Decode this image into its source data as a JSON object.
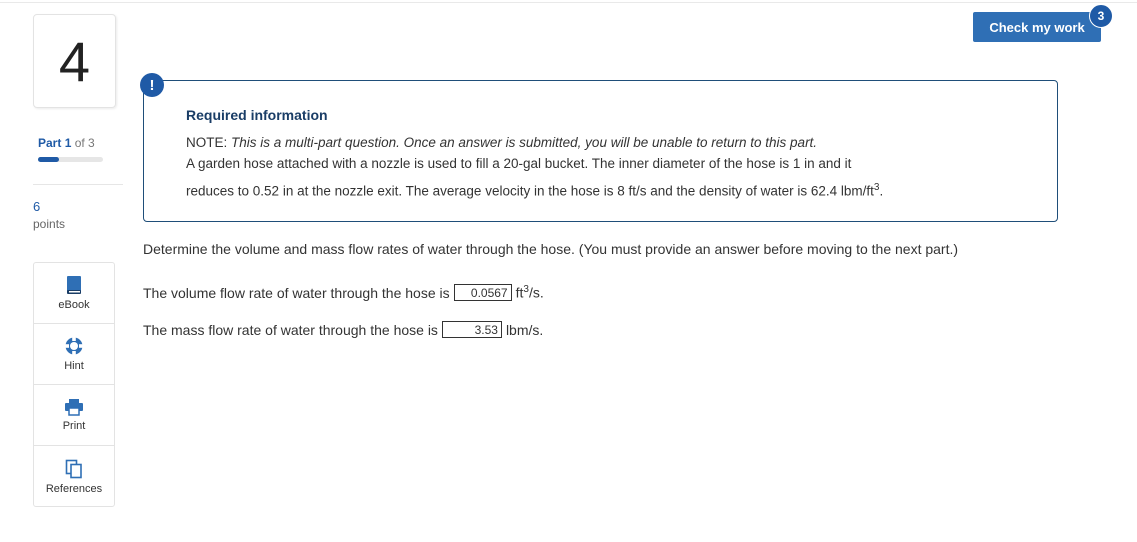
{
  "question_number": "4",
  "part": {
    "prefix": "Part",
    "current": "1",
    "of_text": "of 3",
    "progress": 0.33
  },
  "points": {
    "value": "6",
    "label": "points"
  },
  "tools": [
    {
      "label": "eBook",
      "icon": "book-icon"
    },
    {
      "label": "Hint",
      "icon": "lifebuoy-icon"
    },
    {
      "label": "Print",
      "icon": "printer-icon"
    },
    {
      "label": "References",
      "icon": "copy-icon"
    }
  ],
  "check_button": {
    "label": "Check my work",
    "badge": "3"
  },
  "alert_icon": "!",
  "info": {
    "title": "Required information",
    "note_label": "NOTE:",
    "note_text": "This is a multi-part question. Once an answer is submitted, you will be unable to return to this part.",
    "body_line1": "A garden hose attached with a nozzle is used to fill a 20-gal bucket. The inner diameter of the hose is 1 in and it",
    "body_line2": "reduces to 0.52 in at the nozzle exit. The average velocity in the hose is 8 ft/s and the density of water is 62.4 lbm/ft",
    "body_line2_sup": "3",
    "body_line2_end": "."
  },
  "prompt": "Determine the volume and mass flow rates of water through the hose. (You must provide an answer before moving to the next part.)",
  "answers": {
    "volume": {
      "label": "The volume flow rate of water through the hose is",
      "value": "0.0567",
      "unit": "ft",
      "unit_sup": "3",
      "unit_end": "/s."
    },
    "mass": {
      "label": "The mass flow rate of water through the hose is",
      "value": "3.53",
      "unit": "lbm/s."
    }
  },
  "colors": {
    "accent": "#1f5aa6",
    "button": "#2f6fb5",
    "box_border": "#1f4e79"
  }
}
